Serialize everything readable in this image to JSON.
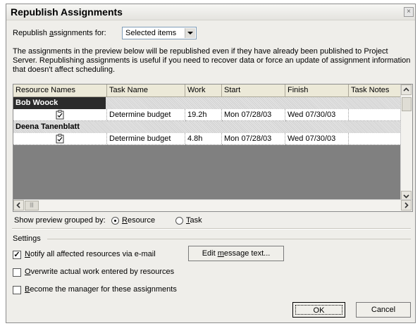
{
  "dialog": {
    "title": "Republish Assignments",
    "close_glyph": "×"
  },
  "republish_for": {
    "label_pre": "Republish ",
    "label_u": "a",
    "label_post": "ssignments for:",
    "selected": "Selected items"
  },
  "description": "The assignments in the preview below will be republished even if they have already been published to Project Server. Republishing assignments is useful if you need to recover data or force an update of assignment information that doesn't affect scheduling.",
  "grid": {
    "columns": [
      "Resource Names",
      "Task Name",
      "Work",
      "Start",
      "Finish",
      "Task Notes"
    ],
    "groups": [
      {
        "name": "Bob Woock",
        "rows": [
          {
            "task": "Determine budget",
            "work": "19.2h",
            "start": "Mon 07/28/03",
            "finish": "Wed 07/30/03",
            "notes": ""
          }
        ]
      },
      {
        "name": "Deena Tanenblatt",
        "rows": [
          {
            "task": "Determine budget",
            "work": "4.8h",
            "start": "Mon 07/28/03",
            "finish": "Wed 07/30/03",
            "notes": ""
          }
        ]
      }
    ],
    "row_icon": "assignment-icon",
    "hscroll_thumb_glyph": "|||"
  },
  "group_by": {
    "label": "Show preview grouped by:",
    "resource_u": "R",
    "resource_rest": "esource",
    "task_u": "T",
    "task_rest": "ask",
    "selected": "Resource"
  },
  "settings": {
    "heading": "Settings",
    "notify_u": "N",
    "notify_rest": "otify all affected resources via e-mail",
    "notify_checked": true,
    "edit_pre": "Edit ",
    "edit_u": "m",
    "edit_post": "essage text...",
    "overwrite_u": "O",
    "overwrite_rest": "verwrite actual work entered by resources",
    "overwrite_checked": false,
    "manager_u": "B",
    "manager_rest": "ecome the manager for these assignments",
    "manager_checked": false
  },
  "buttons": {
    "ok": "OK",
    "cancel": "Cancel"
  }
}
